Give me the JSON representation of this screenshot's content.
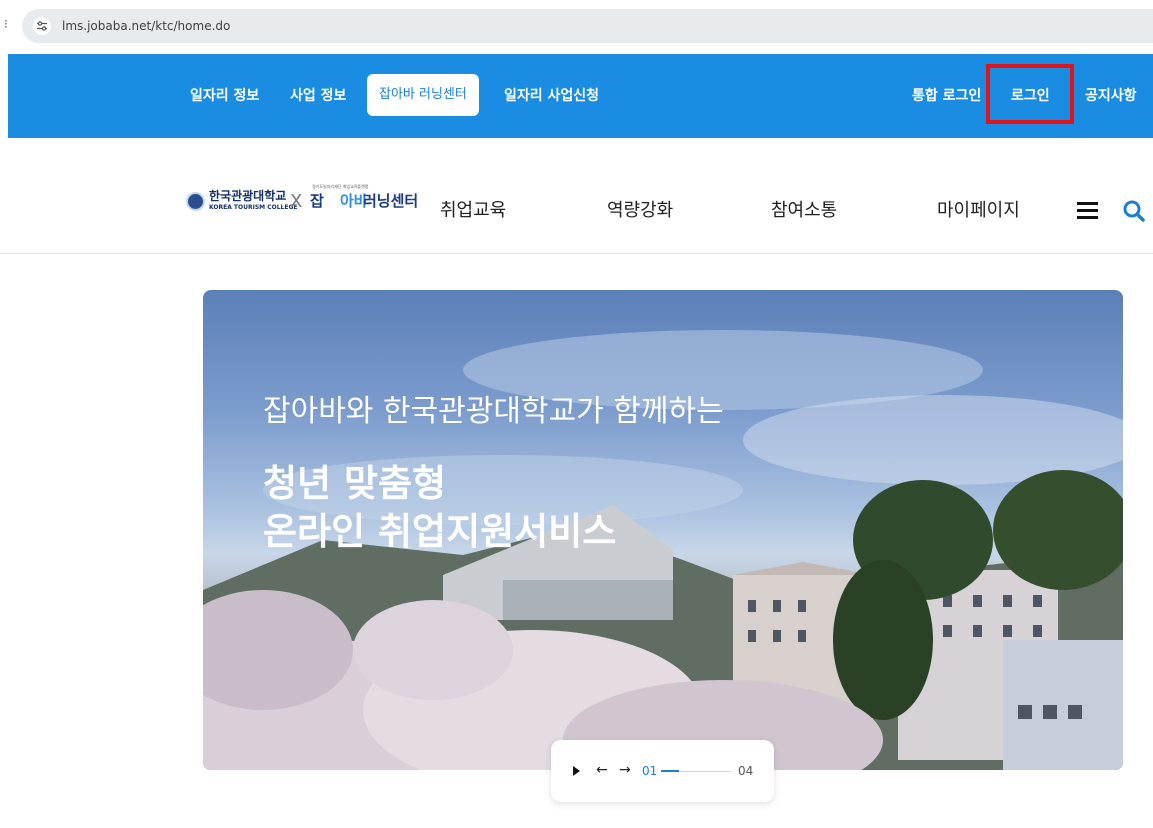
{
  "browser": {
    "url": "lms.jobaba.net/ktc/home.do"
  },
  "top_nav": {
    "left_links": [
      "일자리 정보",
      "사업 정보",
      "잡아바 러닝센터",
      "일자리 사업신청"
    ],
    "active_link": "잡아바 러닝센터",
    "right_links": [
      "통합 로그인",
      "로그인",
      "공지사항"
    ],
    "highlight_color": "#e0131b",
    "bg_color": "#1a8de3"
  },
  "sub_nav": {
    "logo": {
      "korean_name": "한국관광대학교",
      "english_name": "KOREA TOURISM COLLEGE",
      "separator": "X",
      "jobaba_tag": "경기도일자리재단 취업교육플랫폼",
      "jobaba_part1": "잡",
      "jobaba_part2": "아바",
      "jobaba_part3": "러닝센터"
    },
    "items": [
      "취업교육",
      "역량강화",
      "참여소통",
      "마이페이지"
    ],
    "menu_icon": "hamburger-menu-icon",
    "search_icon": "search-icon"
  },
  "hero": {
    "subtitle": "잡아바와 한국관광대학교가 함께하는",
    "title_line1": "청년 맞춤형",
    "title_line2": "온라인 취업지원서비스"
  },
  "slider": {
    "play_icon": "play-icon",
    "prev_icon": "arrow-left-icon",
    "next_icon": "arrow-right-icon",
    "prev_label": "←",
    "next_label": "→",
    "current": "01",
    "total": "04",
    "progress_fraction": 0.25
  }
}
